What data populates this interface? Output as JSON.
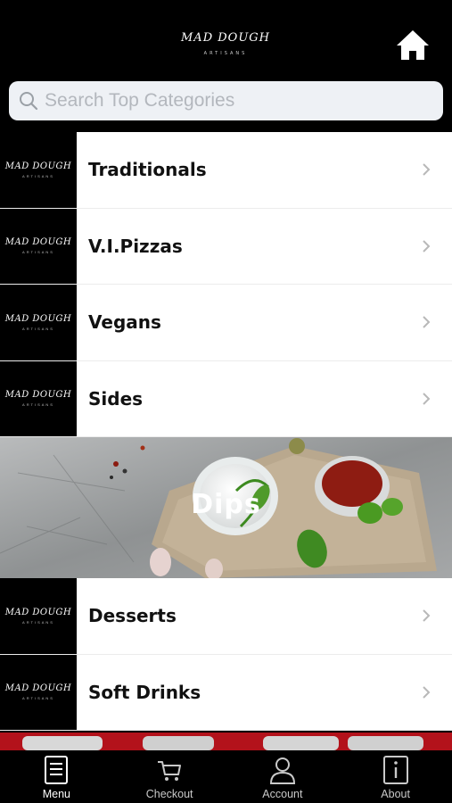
{
  "header": {
    "logo_main": "MAD DOUGH",
    "logo_sub": "ARTISANS",
    "home_icon": "home-icon"
  },
  "search": {
    "placeholder": "Search Top Categories",
    "value": ""
  },
  "categories": [
    {
      "label": "Traditionals",
      "thumb_main": "MAD DOUGH",
      "thumb_sub": "ARTISANS"
    },
    {
      "label": "V.I.Pizzas",
      "thumb_main": "MAD DOUGH",
      "thumb_sub": "ARTISANS"
    },
    {
      "label": "Vegans",
      "thumb_main": "MAD DOUGH",
      "thumb_sub": "ARTISANS"
    },
    {
      "label": "Sides",
      "thumb_main": "MAD DOUGH",
      "thumb_sub": "ARTISANS"
    }
  ],
  "banner": {
    "label": "Dips"
  },
  "categories_after": [
    {
      "label": "Desserts",
      "thumb_main": "MAD DOUGH",
      "thumb_sub": "ARTISANS"
    },
    {
      "label": "Soft Drinks",
      "thumb_main": "MAD DOUGH",
      "thumb_sub": "ARTISANS"
    }
  ],
  "tabs": [
    {
      "label": "Menu",
      "icon": "menu-book-icon",
      "active": true
    },
    {
      "label": "Checkout",
      "icon": "cart-icon",
      "active": false
    },
    {
      "label": "Account",
      "icon": "user-icon",
      "active": false
    },
    {
      "label": "About",
      "icon": "info-icon",
      "active": false
    }
  ],
  "colors": {
    "background": "#000000",
    "row_background": "#ffffff",
    "search_background": "#eef1f5",
    "accent_red": "#b3121b"
  }
}
